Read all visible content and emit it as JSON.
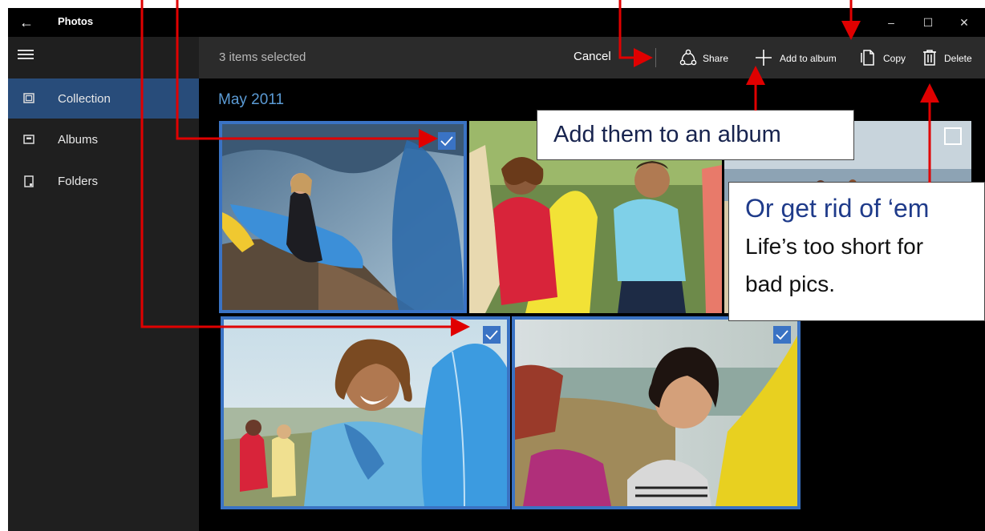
{
  "titlebar": {
    "back_glyph": "←",
    "app_title": "Photos",
    "minimize_glyph": "–",
    "maximize_glyph": "☐",
    "close_glyph": "✕"
  },
  "sidebar": {
    "items": [
      {
        "label": "Collection",
        "icon": "collection-icon",
        "active": true
      },
      {
        "label": "Albums",
        "icon": "albums-icon",
        "active": false
      },
      {
        "label": "Folders",
        "icon": "folders-icon",
        "active": false
      }
    ]
  },
  "commandbar": {
    "selected_count": "3 items selected",
    "cancel": "Cancel",
    "share": "Share",
    "add_to_album": "Add to album",
    "copy": "Copy",
    "delete": "Delete"
  },
  "content": {
    "section_title": "May 2011",
    "photos": [
      {
        "name": "woman-surfboard-beach",
        "selected": true
      },
      {
        "name": "couple-surfboard",
        "selected": false
      },
      {
        "name": "beach-wide",
        "selected": false
      },
      {
        "name": "man-surfboard-smiling",
        "selected": true
      },
      {
        "name": "woman-smiling-beach",
        "selected": true
      }
    ]
  },
  "annotations": {
    "add_callout": "Add them to an album",
    "delete_callout_title": "Or get rid of ‘em",
    "delete_callout_line1": "Life’s too short for",
    "delete_callout_line2": "bad pics."
  },
  "colors": {
    "accent": "#3a73c4",
    "section_title": "#5b9bd5",
    "sidebar_active": "#284c7a",
    "arrow": "#e00000"
  }
}
